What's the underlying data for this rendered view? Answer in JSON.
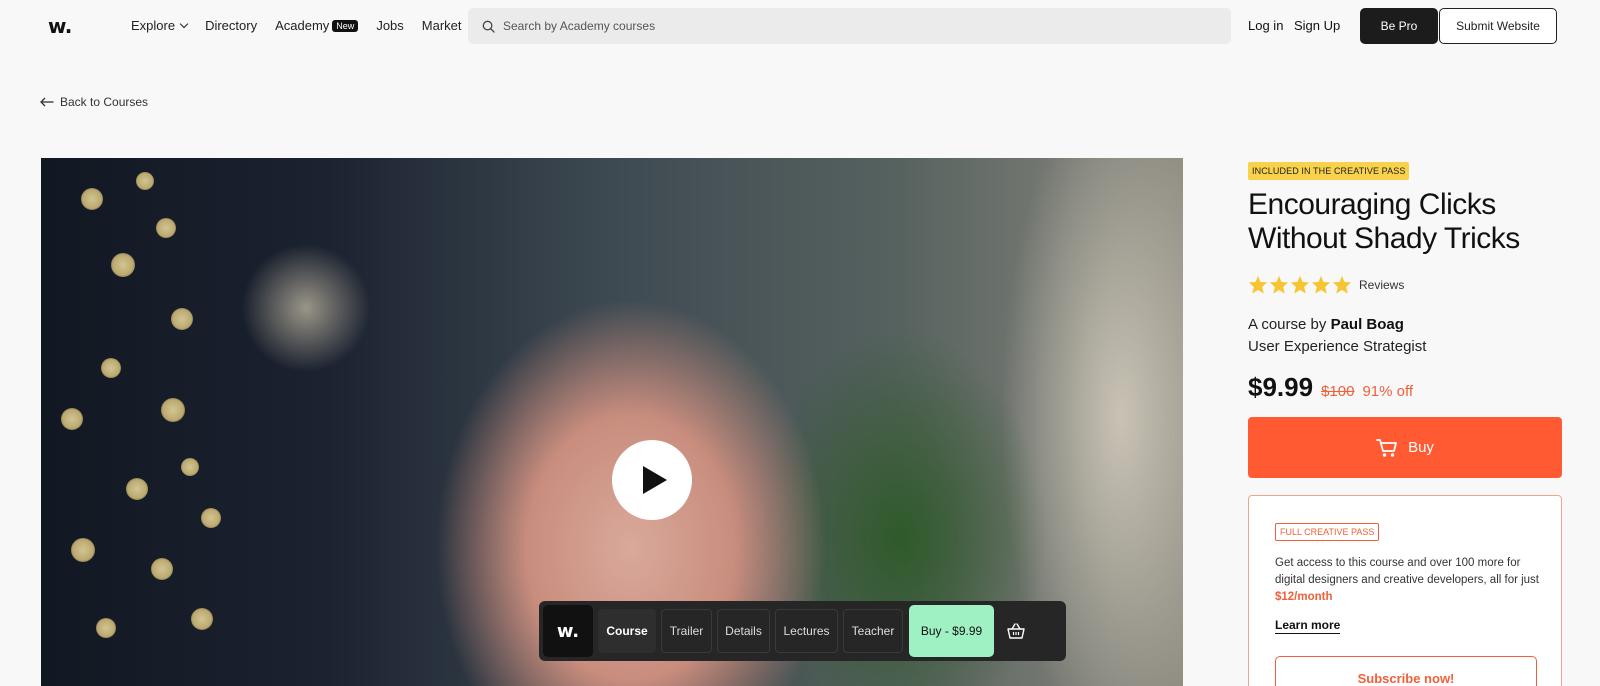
{
  "brand": {
    "logo": "w.",
    "accent": "#ff5a31",
    "pass_yellow": "#f7d24a",
    "buy_green": "#9ff0c3"
  },
  "nav": {
    "items": [
      {
        "label": "Explore",
        "has_dropdown": true
      },
      {
        "label": "Directory"
      },
      {
        "label": "Academy",
        "badge": "New"
      },
      {
        "label": "Jobs"
      },
      {
        "label": "Market"
      }
    ],
    "search_placeholder": "Search by Academy courses",
    "login": "Log in",
    "signup": "Sign Up",
    "be_pro": "Be Pro",
    "submit": "Submit Website"
  },
  "back_link": "Back to Courses",
  "video": {
    "icon": "play-icon",
    "bar": {
      "logo": "w.",
      "tabs": [
        "Course",
        "Trailer",
        "Details",
        "Lectures",
        "Teacher"
      ],
      "active_tab": "Course",
      "buy": "Buy - $9.99",
      "basket_icon": "basket-icon"
    }
  },
  "course": {
    "pass_tag": "INCLUDED IN THE CREATIVE PASS",
    "title": "Encouraging Clicks Without Shady Tricks",
    "rating_stars": 5,
    "reviews_label": "Reviews",
    "by_prefix": "A course by",
    "author": "Paul Boag",
    "author_role": "User Experience Strategist",
    "price": "$9.99",
    "old_price": "$100",
    "discount": "91% off",
    "buy_label": "Buy"
  },
  "creative_pass": {
    "tag": "FULL CREATIVE PASS",
    "text": "Get access to this course and over 100 more for digital designers and creative developers, all for just",
    "price": "$12/month",
    "learn_more": "Learn more",
    "subscribe": "Subscribe now!"
  }
}
